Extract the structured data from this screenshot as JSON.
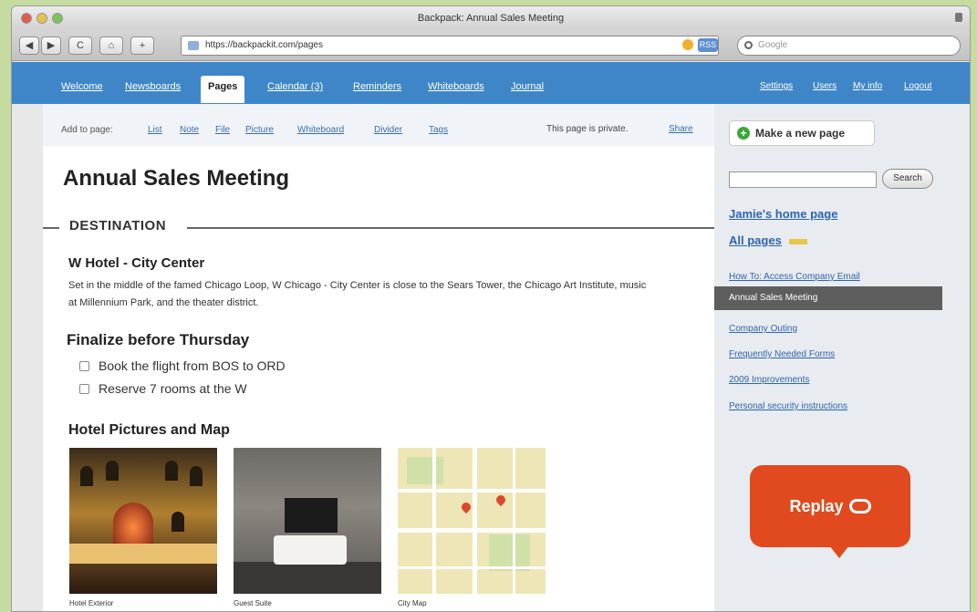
{
  "window": {
    "title": "Backpack: Annual Sales Meeting",
    "url": "https://backpackit.com/pages",
    "google_placeholder": "Google",
    "rss_badge": "RSS"
  },
  "browser_buttons": {
    "back": "◀",
    "forward": "▶",
    "reload": "C",
    "home": "⌂",
    "add": "+"
  },
  "nav": {
    "tabs": [
      "Welcome",
      "Newsboards",
      "Pages",
      "Calendar (3)",
      "Reminders",
      "Whiteboards",
      "Journal"
    ],
    "active_tab": "Pages",
    "right_links": [
      "Settings",
      "Users",
      "My info",
      "Logout"
    ]
  },
  "addbar": {
    "label": "Add to page:",
    "items": [
      "List",
      "Note",
      "File",
      "Picture",
      "Whiteboard",
      "Divider",
      "Tags"
    ],
    "privacy": "This page is private.",
    "share": "Share"
  },
  "page": {
    "title": "Annual Sales Meeting",
    "section": "DESTINATION",
    "hotel_name": "W Hotel - City Center",
    "hotel_desc": "Set in the middle of the famed Chicago Loop, W Chicago - City Center is close to the Sears Tower, the Chicago Art Institute, music at Millennium Park, and the theater district.",
    "todo_title": "Finalize before Thursday",
    "todos": [
      "Book the flight from BOS to ORD",
      "Reserve 7 rooms at the W"
    ],
    "pictures_title": "Hotel Pictures and Map",
    "pictures": [
      "Hotel Exterior",
      "Guest Suite",
      "City Map"
    ]
  },
  "sidebar": {
    "new_page": "Make a new page",
    "search_button": "Search",
    "home_link": "Jamie's home page",
    "all_pages": "All pages",
    "pages": [
      "How To: Access Company Email",
      "Annual Sales Meeting",
      "Company Outing",
      "Frequently Needed Forms",
      "2009 Improvements",
      "Personal security instructions"
    ],
    "current_page": "Annual Sales Meeting"
  },
  "replay": {
    "label": "Replay"
  },
  "colors": {
    "nav_blue": "#3f86c9",
    "replay_orange": "#e04a1e",
    "link_blue": "#2e65b1"
  }
}
